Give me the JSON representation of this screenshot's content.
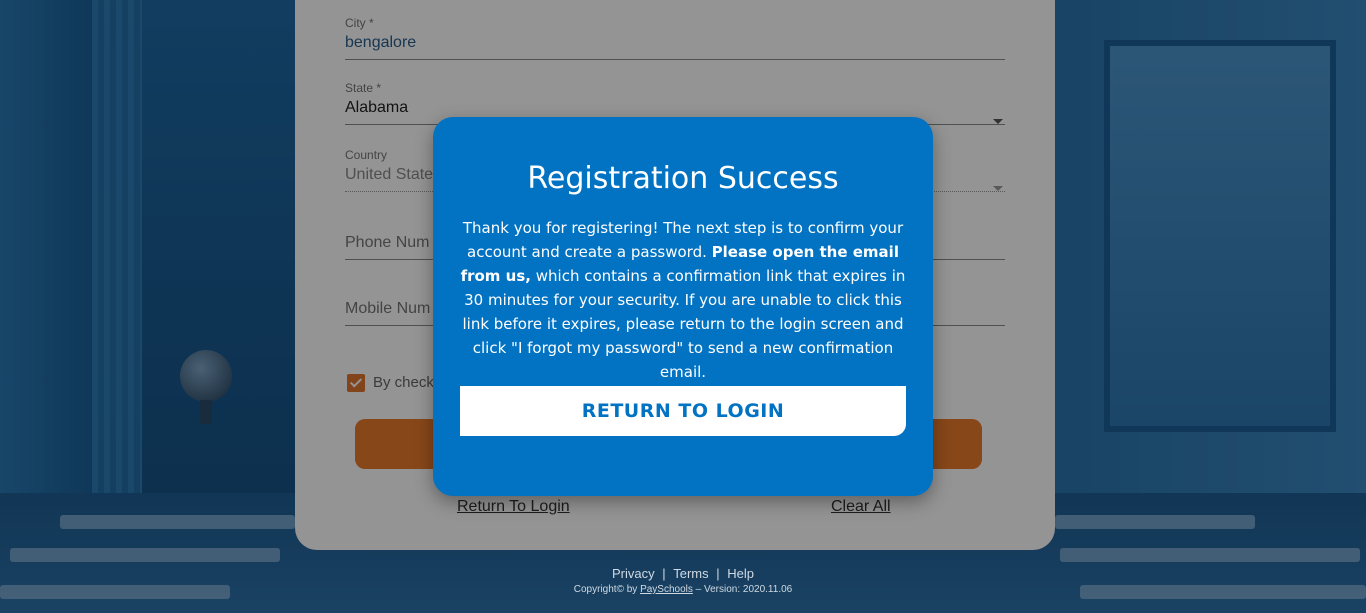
{
  "form": {
    "city": {
      "label": "City *",
      "value": "bengalore"
    },
    "state": {
      "label": "State *",
      "value": "Alabama"
    },
    "country": {
      "label": "Country",
      "value": "United State"
    },
    "phone": {
      "placeholder": "Phone Num"
    },
    "mobile": {
      "placeholder": "Mobile Num"
    },
    "terms_checkbox": {
      "label": "By check",
      "checked": true
    },
    "return_link": "Return To Login",
    "clear_link": "Clear All"
  },
  "modal": {
    "title": "Registration Success",
    "message_part1": "Thank you for registering! The next step is to confirm your account and create a password.",
    "message_bold": "Please open the email from us,",
    "message_part2": "which contains a confirmation link that expires in 30 minutes for your security. If you are unable to click this link before it expires, please return to the login screen and click \"I forgot my password\" to send a new confirmation email.",
    "button_label": "RETURN TO LOGIN"
  },
  "footer": {
    "privacy": "Privacy",
    "terms": "Terms",
    "help": "Help",
    "sep": "|",
    "copyright_prefix": "Copyright© by",
    "company": "PaySchools",
    "version": "– Version: 2020.11.06"
  },
  "colors": {
    "modal_bg": "#0272c3",
    "accent_orange": "#e87a2b",
    "button_text": "#0272c3"
  }
}
